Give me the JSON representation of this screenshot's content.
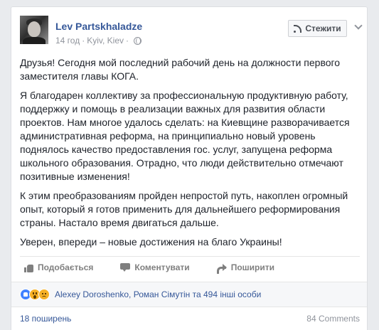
{
  "post": {
    "author": "Lev Partskhaladze",
    "time": "14 год",
    "separator": "·",
    "location": "Kyiv, Kiev",
    "follow_label": "Стежити",
    "paragraphs": [
      "Друзья! Сегодня мой последний рабочий день на должности первого заместителя главы КОГА.",
      "Я благодарен коллективу за профессиональную продуктивную работу, поддержку и помощь в реализации важных для развития области проектов. Нам многое удалось сделать: на Киевщине разворачивается административная реформа, на принципиально новый уровень поднялось качество предоставления гос. услуг, запущена реформа школьного образования. Отрадно, что люди действительно отмечают позитивные изменения!",
      "К этим преобразованиям пройден непростой путь, накоплен огромный опыт, который я готов применить для дальнейшего реформирования страны. Настало время двигаться дальше.",
      "Уверен, впереди – новые достижения на благо Украины!"
    ]
  },
  "actions": {
    "like": "Подобається",
    "comment": "Коментувати",
    "share": "Поширити"
  },
  "reactions": {
    "icons": [
      "like-reaction-icon",
      "wow-reaction-icon",
      "sad-reaction-icon"
    ],
    "names": "Alexey Doroshenko, Роман Сімутін та 494 інші особи"
  },
  "footer": {
    "shares": "18 поширень",
    "comments": "84 Comments"
  },
  "colors": {
    "link": "#365899",
    "background": "#e9ebee",
    "muted": "#90949c"
  }
}
